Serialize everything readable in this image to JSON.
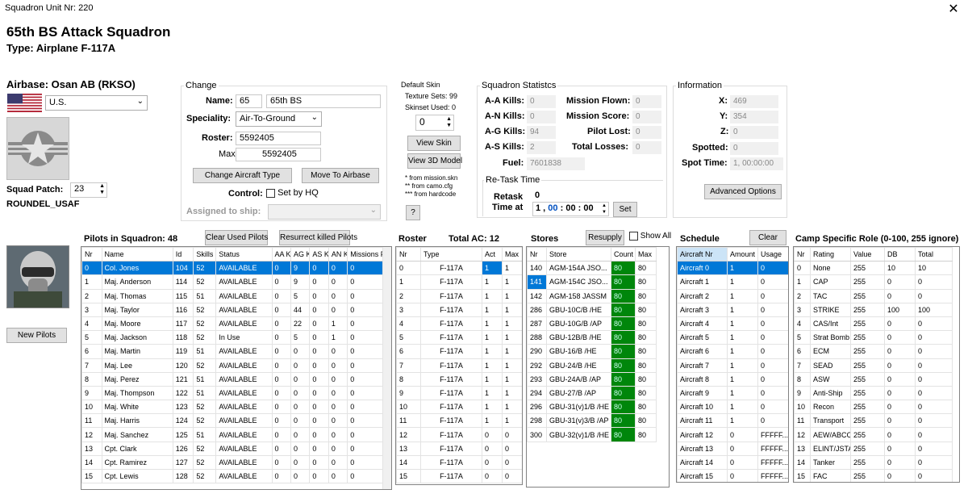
{
  "window": {
    "title": "Squadron Unit Nr: 220",
    "close": "✕"
  },
  "header": {
    "name": "65th BS Attack Squadron",
    "type": "Type: Airplane F-117A"
  },
  "airbase": {
    "label": "Airbase: Osan AB (RKSO)",
    "country": "U.S.",
    "patch_label": "Squad Patch:",
    "patch_value": "23",
    "patch_name": "ROUNDEL_USAF",
    "new_pilots": "New Pilots"
  },
  "change": {
    "title": "Change",
    "name_label": "Name:",
    "name_num": "65",
    "name_value": "65th BS",
    "speciality_label": "Speciality:",
    "speciality_value": "Air-To-Ground",
    "roster_label": "Roster:",
    "roster_value": "5592405",
    "max_label": "Max:",
    "max_value": "5592405",
    "change_ac": "Change Aircraft Type",
    "move_ab": "Move To Airbase",
    "control_label": "Control:",
    "control_check": "Set by HQ",
    "ship_label": "Assigned to ship:"
  },
  "skin": {
    "title": "Default Skin",
    "texture": "Texture Sets: 99",
    "skinset": "Skinset Used: 0",
    "value": "0",
    "view_skin": "View Skin",
    "view_3d": "View 3D Model",
    "note1": "*  from mission.skn",
    "note2": "** from camo.cfg",
    "note3": "*** from hardcode",
    "help": "?"
  },
  "stats": {
    "title": "Squadron Statistcs",
    "aa_label": "A-A Kills:",
    "aa": "0",
    "an_label": "A-N Kills:",
    "an": "0",
    "ag_label": "A-G Kills:",
    "ag": "94",
    "as_label": "A-S Kills:",
    "as": "2",
    "mf_label": "Mission Flown:",
    "mf": "0",
    "ms_label": "Mission Score:",
    "ms": "0",
    "pl_label": "Pilot Lost:",
    "pl": "0",
    "tl_label": "Total Losses:",
    "tl": "0",
    "fuel_label": "Fuel:",
    "fuel": "7601838",
    "retask_title": "Re-Task Time",
    "retask_label": "Retask",
    "retask_value": "0",
    "time_label": "Time at",
    "time_day": "1",
    "time_h": "00",
    "time_m": "00",
    "time_s": "00",
    "set": "Set"
  },
  "info": {
    "title": "Information",
    "x_label": "X:",
    "x": "469",
    "y_label": "Y:",
    "y": "354",
    "z_label": "Z:",
    "z": "0",
    "sp_label": "Spotted:",
    "sp": "0",
    "st_label": "Spot Time:",
    "st": "1, 00:00:00",
    "adv": "Advanced Options"
  },
  "pilots": {
    "title": "Pilots in Squadron: 48",
    "clear": "Clear Used Pilots",
    "resurrect": "Resurrect killed Pilots",
    "headers": [
      "Nr",
      "Name",
      "Id",
      "Skills",
      "Status",
      "AA Kills",
      "AG Kills",
      "AS Kills",
      "AN Kills",
      "Missions Flown"
    ],
    "rows": [
      [
        "0",
        "Col. Jones",
        "104",
        "52",
        "AVAILABLE",
        "0",
        "9",
        "0",
        "0",
        "0"
      ],
      [
        "1",
        "Maj. Anderson",
        "114",
        "52",
        "AVAILABLE",
        "0",
        "9",
        "0",
        "0",
        "0"
      ],
      [
        "2",
        "Maj. Thomas",
        "115",
        "51",
        "AVAILABLE",
        "0",
        "5",
        "0",
        "0",
        "0"
      ],
      [
        "3",
        "Maj. Taylor",
        "116",
        "52",
        "AVAILABLE",
        "0",
        "44",
        "0",
        "0",
        "0"
      ],
      [
        "4",
        "Maj. Moore",
        "117",
        "52",
        "AVAILABLE",
        "0",
        "22",
        "0",
        "1",
        "0"
      ],
      [
        "5",
        "Maj. Jackson",
        "118",
        "52",
        "In Use",
        "0",
        "5",
        "0",
        "1",
        "0"
      ],
      [
        "6",
        "Maj. Martin",
        "119",
        "51",
        "AVAILABLE",
        "0",
        "0",
        "0",
        "0",
        "0"
      ],
      [
        "7",
        "Maj. Lee",
        "120",
        "52",
        "AVAILABLE",
        "0",
        "0",
        "0",
        "0",
        "0"
      ],
      [
        "8",
        "Maj. Perez",
        "121",
        "51",
        "AVAILABLE",
        "0",
        "0",
        "0",
        "0",
        "0"
      ],
      [
        "9",
        "Maj. Thompson",
        "122",
        "51",
        "AVAILABLE",
        "0",
        "0",
        "0",
        "0",
        "0"
      ],
      [
        "10",
        "Maj. White",
        "123",
        "52",
        "AVAILABLE",
        "0",
        "0",
        "0",
        "0",
        "0"
      ],
      [
        "11",
        "Maj. Harris",
        "124",
        "52",
        "AVAILABLE",
        "0",
        "0",
        "0",
        "0",
        "0"
      ],
      [
        "12",
        "Maj. Sanchez",
        "125",
        "51",
        "AVAILABLE",
        "0",
        "0",
        "0",
        "0",
        "0"
      ],
      [
        "13",
        "Cpt. Clark",
        "126",
        "52",
        "AVAILABLE",
        "0",
        "0",
        "0",
        "0",
        "0"
      ],
      [
        "14",
        "Cpt. Ramirez",
        "127",
        "52",
        "AVAILABLE",
        "0",
        "0",
        "0",
        "0",
        "0"
      ],
      [
        "15",
        "Cpt. Lewis",
        "128",
        "52",
        "AVAILABLE",
        "0",
        "0",
        "0",
        "0",
        "0"
      ]
    ]
  },
  "roster": {
    "title": "Roster",
    "total": "Total AC: 12",
    "headers": [
      "Nr",
      "Type",
      "Act",
      "Max"
    ],
    "rows": [
      [
        "0",
        "F-117A",
        "1",
        "1"
      ],
      [
        "1",
        "F-117A",
        "1",
        "1"
      ],
      [
        "2",
        "F-117A",
        "1",
        "1"
      ],
      [
        "3",
        "F-117A",
        "1",
        "1"
      ],
      [
        "4",
        "F-117A",
        "1",
        "1"
      ],
      [
        "5",
        "F-117A",
        "1",
        "1"
      ],
      [
        "6",
        "F-117A",
        "1",
        "1"
      ],
      [
        "7",
        "F-117A",
        "1",
        "1"
      ],
      [
        "8",
        "F-117A",
        "1",
        "1"
      ],
      [
        "9",
        "F-117A",
        "1",
        "1"
      ],
      [
        "10",
        "F-117A",
        "1",
        "1"
      ],
      [
        "11",
        "F-117A",
        "1",
        "1"
      ],
      [
        "12",
        "F-117A",
        "0",
        "0"
      ],
      [
        "13",
        "F-117A",
        "0",
        "0"
      ],
      [
        "14",
        "F-117A",
        "0",
        "0"
      ],
      [
        "15",
        "F-117A",
        "0",
        "0"
      ]
    ]
  },
  "stores": {
    "title": "Stores",
    "resupply": "Resupply",
    "show_all": "Show All",
    "headers": [
      "Nr",
      "Store",
      "Count",
      "Max"
    ],
    "rows": [
      [
        "140",
        "AGM-154A JSO...",
        "80",
        "80"
      ],
      [
        "141",
        "AGM-154C JSO...",
        "80",
        "80"
      ],
      [
        "142",
        "AGM-158 JASSM",
        "80",
        "80"
      ],
      [
        "286",
        "GBU-10C/B /HE",
        "80",
        "80"
      ],
      [
        "287",
        "GBU-10G/B /AP",
        "80",
        "80"
      ],
      [
        "288",
        "GBU-12B/B /HE",
        "80",
        "80"
      ],
      [
        "290",
        "GBU-16/B /HE",
        "80",
        "80"
      ],
      [
        "292",
        "GBU-24/B /HE",
        "80",
        "80"
      ],
      [
        "293",
        "GBU-24A/B /AP",
        "80",
        "80"
      ],
      [
        "294",
        "GBU-27/B /AP",
        "80",
        "80"
      ],
      [
        "296",
        "GBU-31(v)1/B /HE",
        "80",
        "80"
      ],
      [
        "298",
        "GBU-31(v)3/B /AP",
        "80",
        "80"
      ],
      [
        "300",
        "GBU-32(v)1/B /HE",
        "80",
        "80"
      ]
    ]
  },
  "schedule": {
    "title": "Schedule",
    "clear": "Clear",
    "headers": [
      "Aircraft Nr",
      "Amount",
      "Usage"
    ],
    "rows": [
      [
        "Aircraft 0",
        "1",
        "0"
      ],
      [
        "Aircraft 1",
        "1",
        "0"
      ],
      [
        "Aircraft 2",
        "1",
        "0"
      ],
      [
        "Aircraft 3",
        "1",
        "0"
      ],
      [
        "Aircraft 4",
        "1",
        "0"
      ],
      [
        "Aircraft 5",
        "1",
        "0"
      ],
      [
        "Aircraft 6",
        "1",
        "0"
      ],
      [
        "Aircraft 7",
        "1",
        "0"
      ],
      [
        "Aircraft 8",
        "1",
        "0"
      ],
      [
        "Aircraft 9",
        "1",
        "0"
      ],
      [
        "Aircraft 10",
        "1",
        "0"
      ],
      [
        "Aircraft 11",
        "1",
        "0"
      ],
      [
        "Aircraft 12",
        "0",
        "FFFFF..."
      ],
      [
        "Aircraft 13",
        "0",
        "FFFFF..."
      ],
      [
        "Aircraft 14",
        "0",
        "FFFFF..."
      ],
      [
        "Aircraft 15",
        "0",
        "FFFFF..."
      ]
    ]
  },
  "roles": {
    "title": "Camp Specific Role (0-100, 255 ignore)",
    "headers": [
      "Nr",
      "Rating",
      "Value",
      "DB",
      "Total"
    ],
    "rows": [
      [
        "0",
        "None",
        "255",
        "10",
        "10"
      ],
      [
        "1",
        "CAP",
        "255",
        "0",
        "0"
      ],
      [
        "2",
        "TAC",
        "255",
        "0",
        "0"
      ],
      [
        "3",
        "STRIKE",
        "255",
        "100",
        "100"
      ],
      [
        "4",
        "CAS/Int",
        "255",
        "0",
        "0"
      ],
      [
        "5",
        "Strat Bomb",
        "255",
        "0",
        "0"
      ],
      [
        "6",
        "ECM",
        "255",
        "0",
        "0"
      ],
      [
        "7",
        "SEAD",
        "255",
        "0",
        "0"
      ],
      [
        "8",
        "ASW",
        "255",
        "0",
        "0"
      ],
      [
        "9",
        "Anti-Ship",
        "255",
        "0",
        "0"
      ],
      [
        "10",
        "Recon",
        "255",
        "0",
        "0"
      ],
      [
        "11",
        "Transport",
        "255",
        "0",
        "0"
      ],
      [
        "12",
        "AEW/ABCCC",
        "255",
        "0",
        "0"
      ],
      [
        "13",
        "ELINT/JSTAR",
        "255",
        "0",
        "0"
      ],
      [
        "14",
        "Tanker",
        "255",
        "0",
        "0"
      ],
      [
        "15",
        "FAC",
        "255",
        "0",
        "0"
      ]
    ]
  },
  "colors": {
    "selection": "#0078d7",
    "store_count": "#00860b"
  }
}
